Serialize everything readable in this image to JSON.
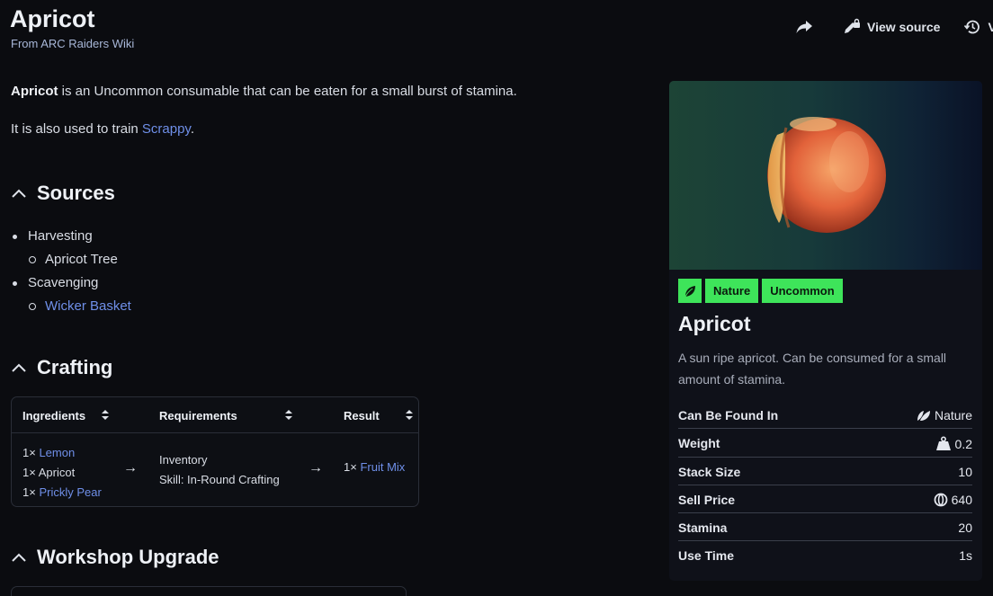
{
  "header": {
    "title": "Apricot",
    "subtitle": "From ARC Raiders Wiki",
    "actions": {
      "share_icon": "share-icon",
      "view_source": "View source",
      "history_label": "Vi"
    }
  },
  "intro": {
    "bold": "Apricot",
    "text": " is an Uncommon consumable that can be eaten for a small burst of stamina.",
    "line2_prefix": "It is also used to train ",
    "line2_link": "Scrappy",
    "line2_suffix": "."
  },
  "sources": {
    "heading": "Sources",
    "items": [
      {
        "label": "Harvesting",
        "children": [
          "Apricot Tree"
        ]
      },
      {
        "label": "Scavenging",
        "children": [
          "Wicker Basket"
        ]
      }
    ]
  },
  "crafting": {
    "heading": "Crafting",
    "columns": [
      "Ingredients",
      "Requirements",
      "Result"
    ],
    "row": {
      "ingredients": [
        {
          "qty": "1×",
          "name": "Lemon",
          "link": true
        },
        {
          "qty": "1×",
          "name": "Apricot",
          "link": false
        },
        {
          "qty": "1×",
          "name": "Prickly Pear",
          "link": true
        }
      ],
      "requirements": [
        "Inventory",
        "Skill: In-Round Crafting"
      ],
      "result": {
        "qty": "1×",
        "name": "Fruit Mix"
      },
      "arrow": "→"
    }
  },
  "workshop": {
    "heading": "Workshop Upgrade"
  },
  "infobox": {
    "badges": {
      "icon": "leaf-icon",
      "category": "Nature",
      "rarity": "Uncommon"
    },
    "title": "Apricot",
    "description": "A sun ripe apricot. Can be consumed for a small amount of stamina.",
    "rows": [
      {
        "key": "Can Be Found In",
        "value": "Nature",
        "icon": "leaf-icon"
      },
      {
        "key": "Weight",
        "value": "0.2",
        "icon": "weight-icon"
      },
      {
        "key": "Stack Size",
        "value": "10"
      },
      {
        "key": "Sell Price",
        "value": "640",
        "icon": "coin-icon"
      },
      {
        "key": "Stamina",
        "value": "20"
      },
      {
        "key": "Use Time",
        "value": "1s"
      }
    ]
  },
  "colors": {
    "accent_green": "#3ee45a",
    "link": "#6f8fe8",
    "background": "#0b0c10"
  }
}
